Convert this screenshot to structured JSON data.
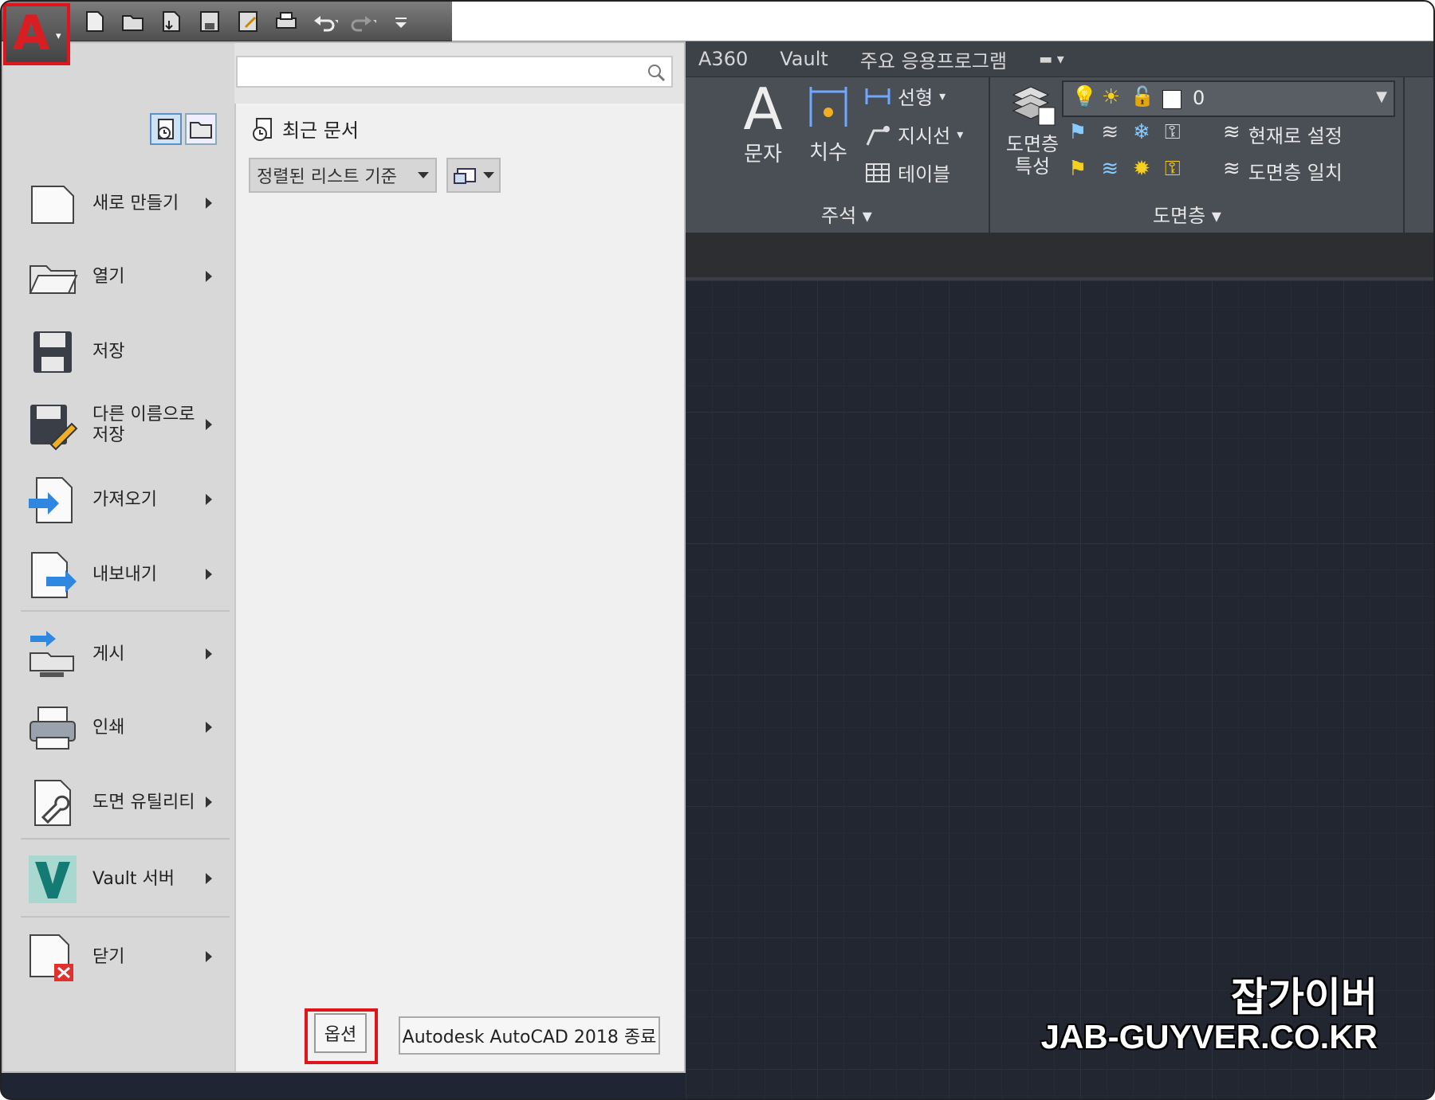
{
  "quick_access": {
    "icons": [
      "new-icon",
      "open-icon",
      "open-from-cloud-icon",
      "save-icon",
      "save-as-icon",
      "plot-icon",
      "undo-icon",
      "redo-icon",
      "customize-icon"
    ]
  },
  "ribbon": {
    "tabs": [
      "A360",
      "Vault",
      "주요 응용프로그램"
    ],
    "annotation": {
      "text": "문자",
      "dimension": "치수",
      "linear": "선형",
      "leader": "지시선",
      "table": "테이블",
      "panel": "주석"
    },
    "layers": {
      "properties_line1": "도면층",
      "properties_line2": "특성",
      "current_layer": "0",
      "set_current": "현재로 설정",
      "match_layer": "도면층 일치",
      "panel": "도면층"
    }
  },
  "app_menu": {
    "items": [
      {
        "label": "새로 만들기",
        "icon": "new-document-icon",
        "submenu": true
      },
      {
        "label": "열기",
        "icon": "open-folder-icon",
        "submenu": true
      },
      {
        "label": "저장",
        "icon": "save-disk-icon",
        "submenu": false
      },
      {
        "label": "다른 이름으로 저장",
        "icon": "save-as-icon",
        "submenu": true
      },
      {
        "label": "가져오기",
        "icon": "import-icon",
        "submenu": true
      },
      {
        "label": "내보내기",
        "icon": "export-icon",
        "submenu": true
      },
      {
        "label": "게시",
        "icon": "publish-icon",
        "submenu": true
      },
      {
        "label": "인쇄",
        "icon": "printer-icon",
        "submenu": true
      },
      {
        "label": "도면 유틸리티",
        "icon": "drawing-utilities-icon",
        "submenu": true
      },
      {
        "label": "Vault 서버",
        "icon": "vault-icon",
        "submenu": true
      },
      {
        "label": "닫기",
        "icon": "close-document-icon",
        "submenu": true
      }
    ],
    "recent_title": "최근 문서",
    "sort_label": "정렬된 리스트 기준",
    "options_button": "옵션",
    "exit_button": "Autodesk AutoCAD 2018 종료"
  },
  "watermark": {
    "line1": "잡가이버",
    "line2": "JAB-GUYVER.CO.KR"
  },
  "colors": {
    "highlight": "#e0151b",
    "canvas": "#212630",
    "ribbon": "#4a4e55"
  }
}
